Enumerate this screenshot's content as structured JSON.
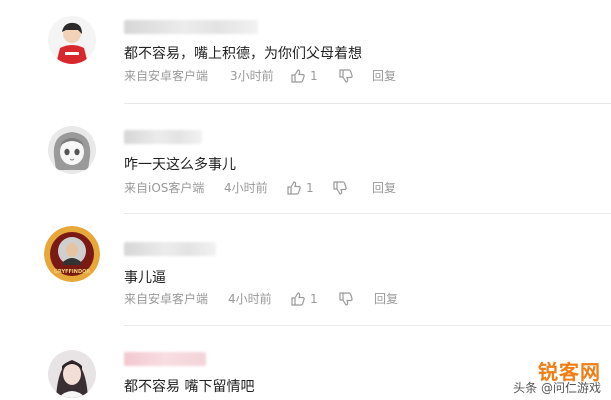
{
  "comments": [
    {
      "text": "都不容易，嘴上积德，为你们父母着想",
      "source": "来自安卓客户端",
      "time": "3小时前",
      "likes": "1",
      "reply": "回复",
      "avatar_icon": "avatar-red-shirt-icon"
    },
    {
      "text": "咋一天这么多事儿",
      "source": "来自iOS客户端",
      "time": "4小时前",
      "likes": "1",
      "reply": "回复",
      "avatar_icon": "avatar-anime-girl-icon"
    },
    {
      "text": "事儿逼",
      "source": "来自安卓客户端",
      "time": "4小时前",
      "likes": "1",
      "reply": "回复",
      "avatar_icon": "avatar-gryffindor-crest-icon"
    },
    {
      "text": "都不容易 嘴下留情吧",
      "avatar_icon": "avatar-girl-photo-icon"
    }
  ],
  "avatar_badge_text": "GRYFFINDOR",
  "watermark": {
    "logo": "锐客网",
    "subtitle": "头条 @问仁游戏"
  },
  "colors": {
    "meta_gray": "#999999",
    "divider": "#e8e8e8",
    "watermark_orange": "#f07d15"
  }
}
